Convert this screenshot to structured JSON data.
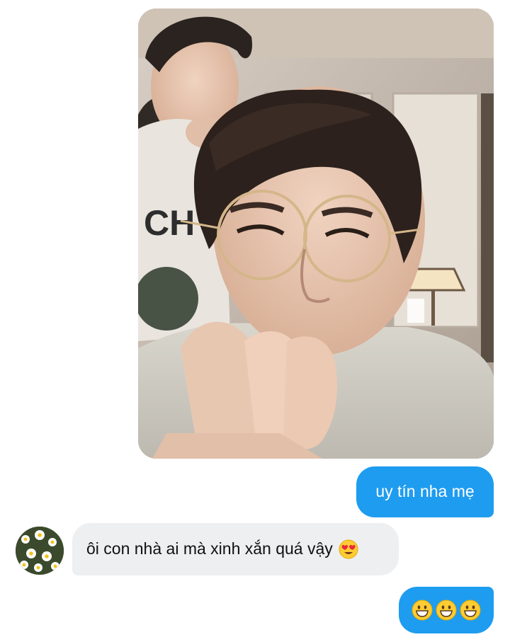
{
  "conversation": {
    "photo_message": {
      "description_icon": "photo-attachment",
      "sender": "self"
    },
    "messages": [
      {
        "sender": "self",
        "text": "uy tín nha mẹ"
      },
      {
        "sender": "other",
        "text": "ôi con nhà ai mà xinh xắn quá vậy",
        "emoji": "heart-eyes-emoji"
      },
      {
        "sender": "self",
        "emojis": [
          "grinning-emoji",
          "grinning-emoji",
          "grinning-emoji"
        ]
      }
    ],
    "colors": {
      "sent_bubble": "#1e9cf0",
      "received_bubble": "#eeeff1",
      "sent_text": "#ffffff",
      "received_text": "#111111"
    },
    "contact": {
      "avatar_icon": "daisy-flowers-avatar"
    }
  }
}
